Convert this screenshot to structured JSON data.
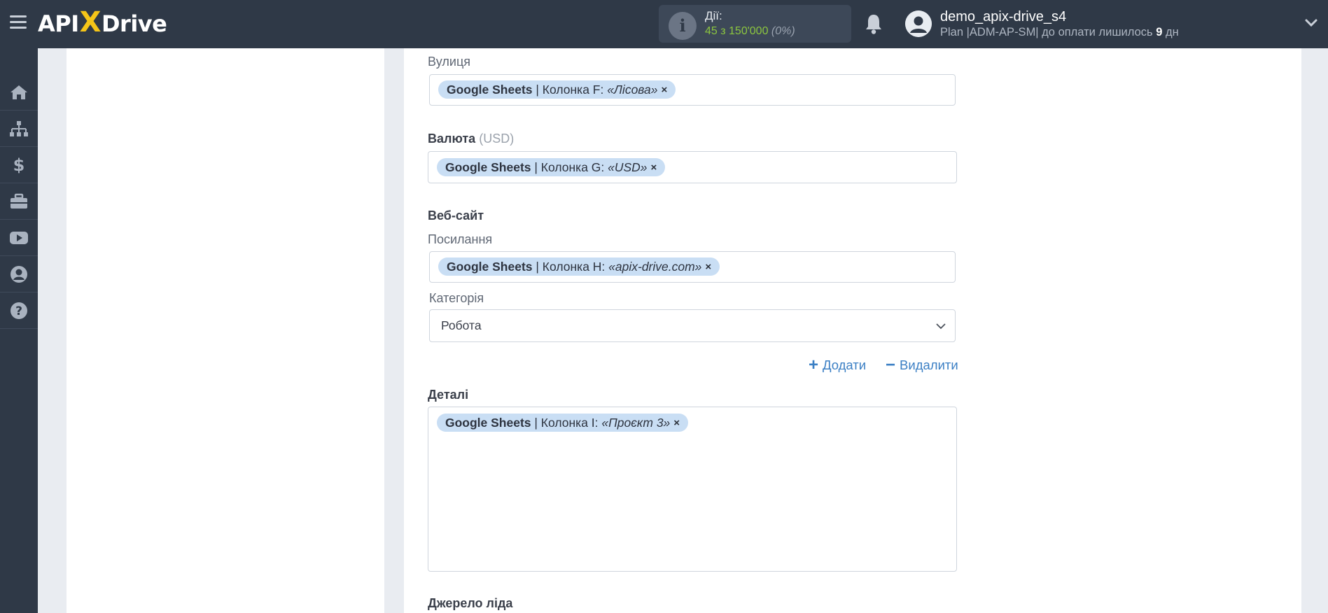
{
  "header": {
    "logo_left": "API",
    "logo_x": "X",
    "logo_right": "Drive",
    "actions_label": "Дії:",
    "actions_count": "45 з 150'000",
    "actions_percent": "(0%)",
    "username": "demo_apix-drive_s4",
    "plan_prefix": "Plan |ADM-AP-SM| до оплати лишилось",
    "plan_days": "9",
    "plan_suffix": "дн",
    "icons": [
      "menu-icon",
      "info-icon",
      "bell-icon",
      "user-avatar-icon",
      "chevron-down-icon"
    ]
  },
  "sidebar": {
    "items": [
      {
        "name": "home-icon"
      },
      {
        "name": "sitemap-icon"
      },
      {
        "name": "dollar-icon"
      },
      {
        "name": "briefcase-icon"
      },
      {
        "name": "youtube-icon"
      },
      {
        "name": "user-circle-icon"
      },
      {
        "name": "help-icon"
      }
    ]
  },
  "form": {
    "street": {
      "label": "Вулиця",
      "tag": {
        "source": "Google Sheets",
        "column": " | Колонка F: ",
        "value": "«Лісова»",
        "remove": "×"
      }
    },
    "currency": {
      "label": "Валюта",
      "hint": "(USD)",
      "tag": {
        "source": "Google Sheets",
        "column": " | Колонка G: ",
        "value": "«USD»",
        "remove": "×"
      }
    },
    "website": {
      "section": "Веб-сайт",
      "link_label": "Посилання",
      "tag": {
        "source": "Google Sheets",
        "column": " | Колонка H: ",
        "value": "«apix-drive.com»",
        "remove": "×"
      },
      "category_label": "Категорія",
      "category_value": "Робота",
      "add_label": "Додати",
      "remove_label": "Видалити"
    },
    "details": {
      "section": "Деталі",
      "tag": {
        "source": "Google Sheets",
        "column": " | Колонка I: ",
        "value": "«Проєкт 3»",
        "remove": "×"
      }
    },
    "lead_source": {
      "section": "Джерело ліда"
    }
  },
  "colors": {
    "topbar": "#2f3947",
    "accent": "#f5c518",
    "tag": "#c9def4",
    "link": "#3b7fc4",
    "counter": "#8cc63f"
  }
}
